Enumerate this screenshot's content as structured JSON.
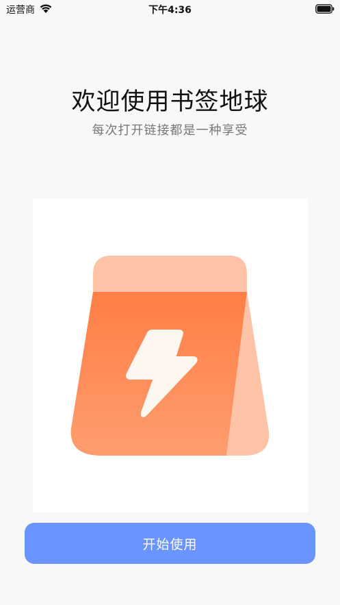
{
  "status_bar": {
    "carrier": "运营商",
    "time": "下午4:36",
    "wifi_icon": "wifi-icon",
    "battery_icon": "battery-icon"
  },
  "welcome": {
    "title": "欢迎使用书签地球",
    "subtitle": "每次打开链接都是一种享受"
  },
  "illustration": {
    "icon": "lightning-bag-icon"
  },
  "actions": {
    "start_label": "开始使用"
  },
  "colors": {
    "background": "#f8f8f8",
    "button": "#6a94ff",
    "bag_front": "#ff8a55",
    "bag_light": "#ffc4a8",
    "bolt": "#fdf7f0"
  }
}
